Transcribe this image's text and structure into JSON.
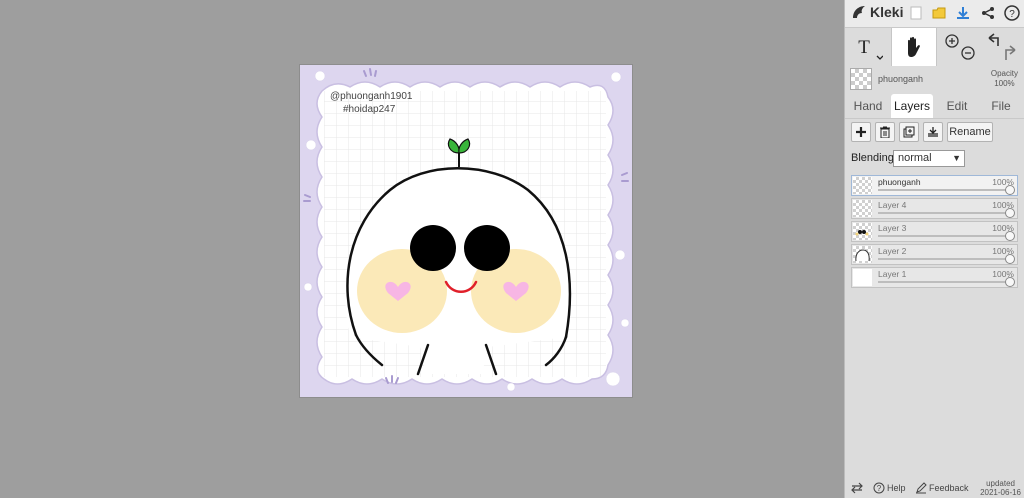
{
  "app": {
    "name": "Kleki"
  },
  "canvas": {
    "text_line1": "@phuonganh1901",
    "text_line2": "#hoidap247"
  },
  "toolbar": {
    "opacity_label": "Opacity",
    "opacity_value": "100%",
    "brush_name": "phuonganh"
  },
  "tabs": [
    {
      "label": "Hand",
      "active": false
    },
    {
      "label": "Layers",
      "active": true
    },
    {
      "label": "Edit",
      "active": false
    },
    {
      "label": "File",
      "active": false
    }
  ],
  "layers_panel": {
    "rename_label": "Rename",
    "blending_label": "Blending",
    "blending_value": "normal",
    "layers": [
      {
        "name": "phuonganh",
        "opacity": "100%",
        "selected": true
      },
      {
        "name": "Layer 4",
        "opacity": "100%",
        "selected": false
      },
      {
        "name": "Layer 3",
        "opacity": "100%",
        "selected": false
      },
      {
        "name": "Layer 2",
        "opacity": "100%",
        "selected": false
      },
      {
        "name": "Layer 1",
        "opacity": "100%",
        "selected": false
      }
    ]
  },
  "bottom": {
    "help_label": "Help",
    "feedback_label": "Feedback",
    "updated_label": "updated",
    "updated_date": "2021-06-16"
  },
  "colors": {
    "accent": "#2f7fd6",
    "frame": "#ddd6ef",
    "blush": "#fbe9b8",
    "heart": "#f7b6e4",
    "mouth": "#e0202a",
    "sprout": "#39b53a"
  }
}
